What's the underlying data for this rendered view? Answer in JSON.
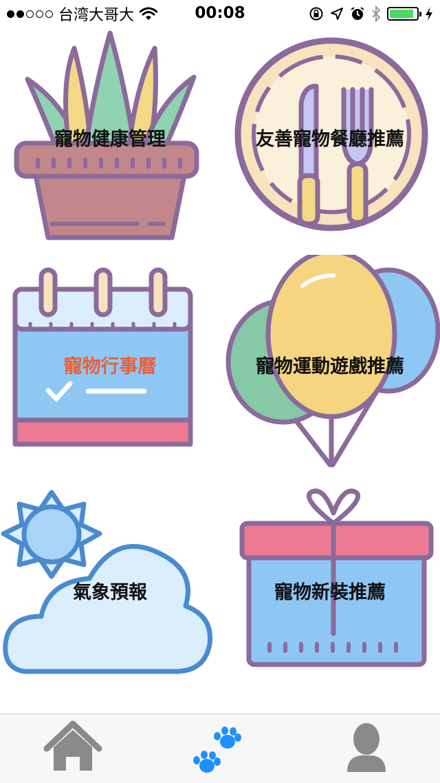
{
  "status_bar": {
    "carrier": "台湾大哥大",
    "time": "00:08",
    "signal_bars_filled": 2,
    "signal_bars_total": 5,
    "battery_level": 0.9
  },
  "menu": {
    "items": [
      {
        "label": "寵物健康管理",
        "icon": "potted-plant-icon"
      },
      {
        "label": "友善寵物餐廳推薦",
        "icon": "plate-knife-fork-icon"
      },
      {
        "label": "寵物行事曆",
        "icon": "calendar-icon",
        "active": true,
        "active_color": "#e8603c"
      },
      {
        "label": "寵物運動遊戲推薦",
        "icon": "balloons-icon"
      },
      {
        "label": "氣象預報",
        "icon": "sun-cloud-icon"
      },
      {
        "label": "寵物新裝推薦",
        "icon": "gift-box-icon"
      }
    ]
  },
  "tab_bar": {
    "tabs": [
      {
        "icon": "home-icon"
      },
      {
        "icon": "paw-prints-icon",
        "selected": true,
        "color": "#1e90ff"
      },
      {
        "icon": "user-icon"
      }
    ]
  }
}
